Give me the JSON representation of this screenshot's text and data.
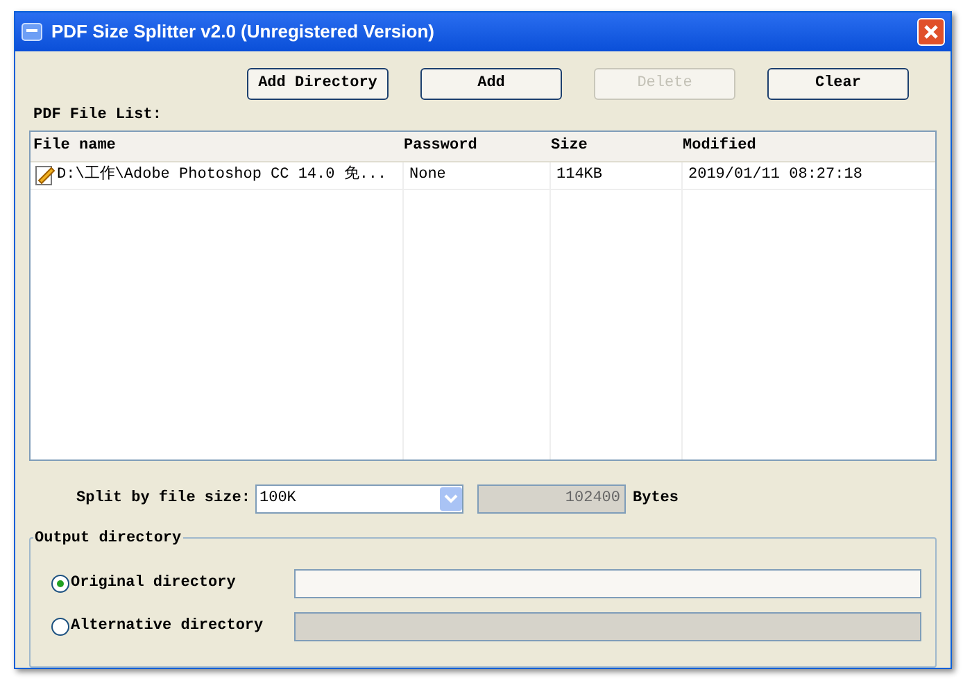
{
  "window": {
    "title": "PDF Size Splitter v2.0 (Unregistered Version)"
  },
  "buttons": [
    {
      "label": "Add Directory",
      "disabled": false
    },
    {
      "label": "Add",
      "disabled": false
    },
    {
      "label": "Delete",
      "disabled": true
    },
    {
      "label": "Clear",
      "disabled": false
    }
  ],
  "file_list": {
    "label": "PDF File List:",
    "columns": [
      "File name",
      "Password",
      "Size",
      "Modified"
    ],
    "rows": [
      {
        "cells": [
          "D:\\工作\\Adobe Photoshop CC 14.0 免...",
          "None",
          "114KB",
          "2019/01/11 08:27:18"
        ]
      }
    ]
  },
  "split": {
    "label": "Split by file size:",
    "value": "100K",
    "bytes": "102400",
    "unit": "Bytes"
  },
  "output": {
    "label": "Output directory",
    "options": [
      {
        "label": "Original directory",
        "selected": true,
        "field_disabled": false
      },
      {
        "label": "Alternative directory",
        "selected": false,
        "field_disabled": true
      }
    ]
  }
}
